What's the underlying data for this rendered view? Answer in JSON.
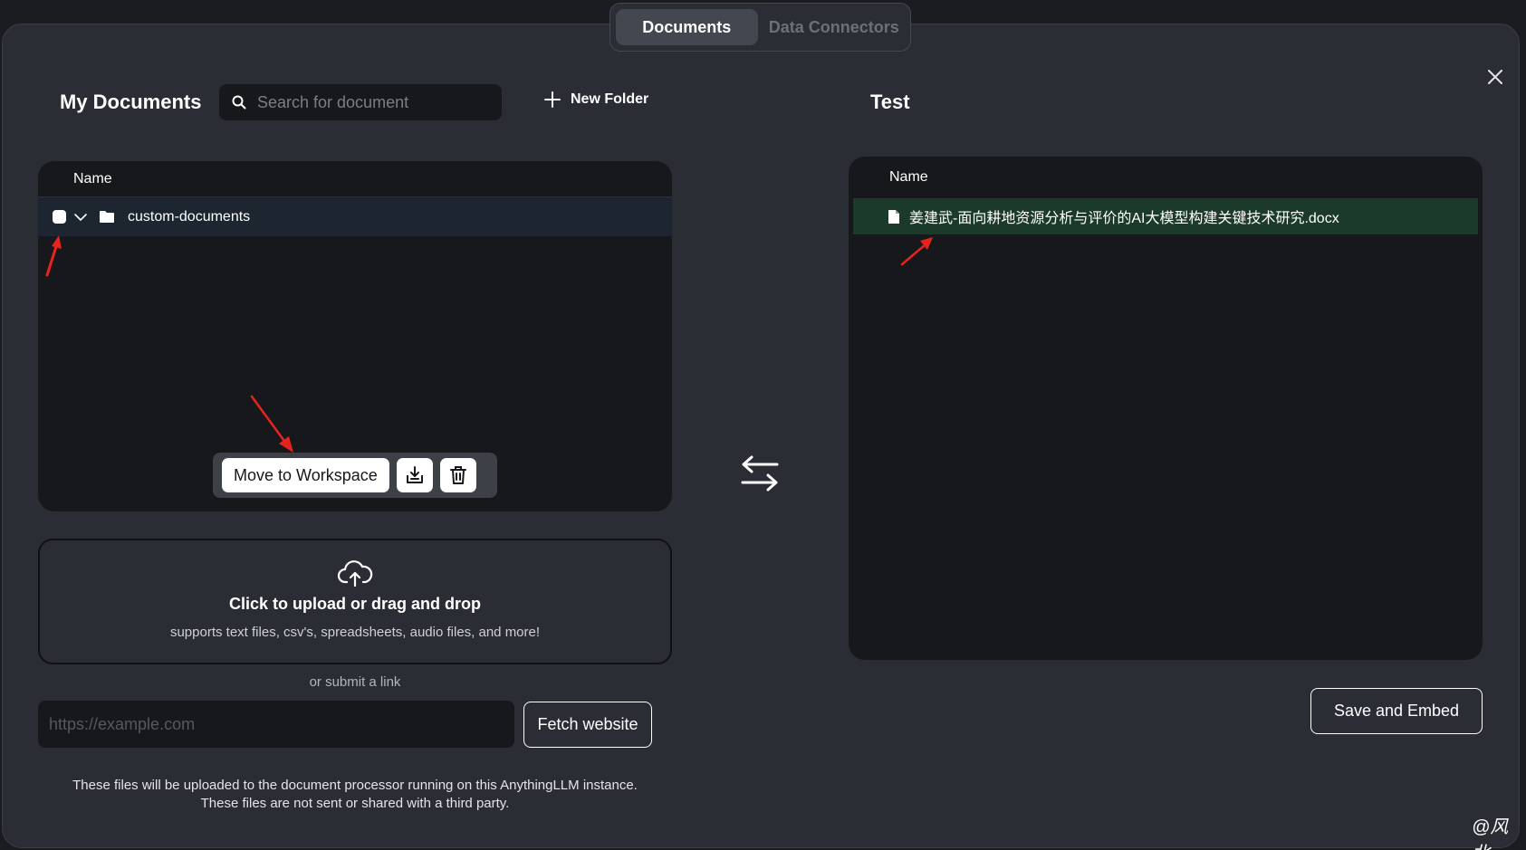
{
  "tabs": [
    {
      "label": "Documents",
      "active": true
    },
    {
      "label": "Data Connectors",
      "active": false
    }
  ],
  "left": {
    "title": "My Documents",
    "search_placeholder": "Search for document",
    "new_folder_label": "New Folder",
    "column_name": "Name",
    "folder": {
      "name": "custom-documents",
      "checked": true,
      "expanded": true
    },
    "actions": {
      "move_label": "Move to Workspace"
    }
  },
  "right": {
    "title": "Test",
    "column_name": "Name",
    "file": {
      "name": "姜建武-面向耕地资源分析与评价的AI大模型构建关键技术研究.docx"
    }
  },
  "upload": {
    "title": "Click to upload or drag and drop",
    "subtitle": "supports text files, csv's, spreadsheets, audio files, and more!",
    "or_link": "or submit a link",
    "url_placeholder": "https://example.com",
    "fetch_label": "Fetch website",
    "note_line1": "These files will be uploaded to the document processor running on this AnythingLLM instance.",
    "note_line2": "These files are not sent or shared with a third party."
  },
  "save_label": "Save and Embed",
  "watermark": "@风北",
  "colors": {
    "modal_bg": "#2a2d33",
    "panel_bg": "#17181b",
    "selected_folder_row": "#1d2630",
    "workspace_file_row": "#1c3a2a",
    "annotation_arrow": "#e8231d"
  }
}
